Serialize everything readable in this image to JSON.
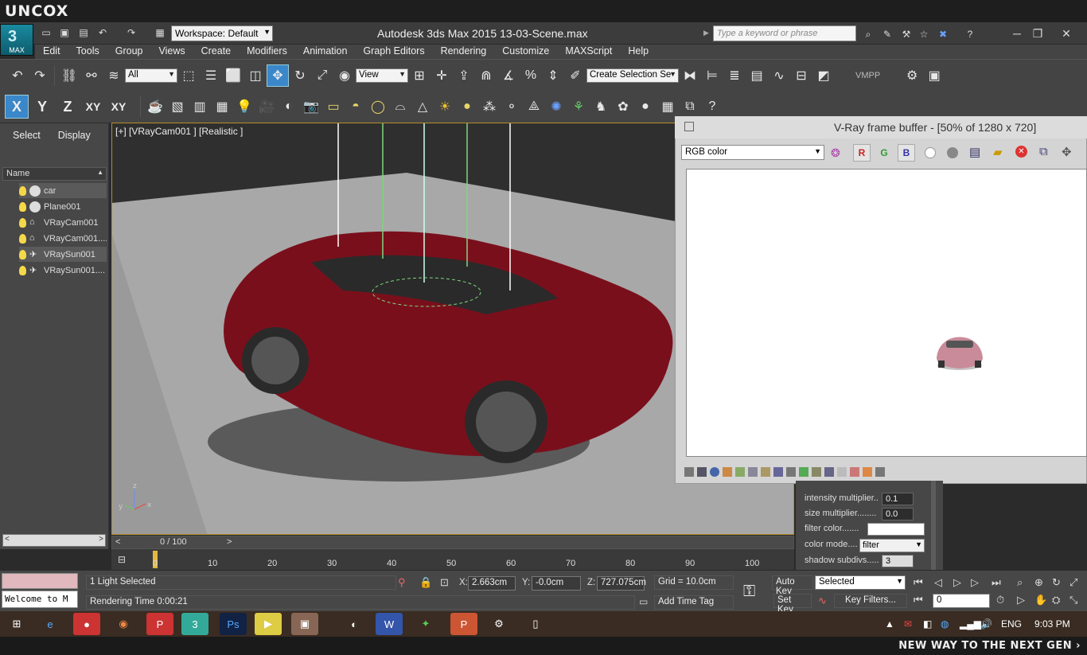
{
  "brand": {
    "watermark": "UNCOX",
    "tagline": "NEW WAY TO THE NEXT GEN ›"
  },
  "titlebar": {
    "app_icon_label": "MAX",
    "workspace": "Workspace: Default",
    "title": "Autodesk 3ds Max  2015     13-03-Scene.max",
    "search_placeholder": "Type a keyword or phrase",
    "icons": [
      "new-file-icon",
      "open-file-icon",
      "save-icon",
      "undo-icon",
      "redo-icon",
      "project-folder-icon",
      "binoculars-icon",
      "key-tools-icon",
      "exchange-icon",
      "star-icon",
      "x-icon",
      "help-icon"
    ]
  },
  "window_controls": {
    "minimize": "─",
    "restore": "❐",
    "close": "✕"
  },
  "menu": [
    "Edit",
    "Tools",
    "Group",
    "Views",
    "Create",
    "Modifiers",
    "Animation",
    "Graph Editors",
    "Rendering",
    "Customize",
    "MAXScript",
    "Help"
  ],
  "toolbar1": {
    "selection_filter": "All",
    "ref_coord": "View",
    "named_selection": "Create Selection Se",
    "vmpp_label": "VMPP"
  },
  "toolbar2": {
    "axes": [
      "X",
      "Y",
      "Z",
      "XY",
      "XY"
    ],
    "active_axis": "X"
  },
  "left_panel": {
    "tabs": [
      "Select",
      "Display"
    ],
    "column_header": "Name",
    "items": [
      {
        "label": "car",
        "icon": "sphere-icon",
        "selected": true
      },
      {
        "label": "Plane001",
        "icon": "sphere-icon",
        "selected": false
      },
      {
        "label": "VRayCam001",
        "icon": "camera-icon",
        "selected": false
      },
      {
        "label": "VRayCam001....",
        "icon": "camera-icon",
        "selected": false
      },
      {
        "label": "VRaySun001",
        "icon": "sun-light-icon",
        "selected": true
      },
      {
        "label": "VRaySun001....",
        "icon": "sun-light-icon",
        "selected": false
      }
    ]
  },
  "viewport": {
    "label": "[+] [VRayCam001 ] [Realistic ]",
    "car_color": "#7a0f1c",
    "floor_color": "#a8a8a8"
  },
  "timeline": {
    "frame": "0 / 100",
    "ticks": [
      "0",
      "10",
      "20",
      "30",
      "40",
      "50",
      "60",
      "70",
      "80",
      "90",
      "100"
    ]
  },
  "vfb": {
    "title": "V-Ray frame buffer - [50% of 1280 x 720]",
    "channel": "RGB color",
    "rgb": [
      "R",
      "G",
      "B"
    ]
  },
  "cmd_panel": {
    "params": [
      {
        "label": "intensity multiplier..",
        "value": "0.1"
      },
      {
        "label": "size multiplier........",
        "value": "0.0"
      },
      {
        "label": "filter color.......",
        "value": ""
      },
      {
        "label": "color mode....",
        "value": "filter"
      },
      {
        "label": "shadow subdivs.....",
        "value": "3"
      }
    ]
  },
  "status": {
    "selection": "1 Light Selected",
    "render_time": "Rendering Time  0:00:21",
    "welcome": "Welcome to M",
    "x": "2.663cm",
    "y": "-0.0cm",
    "z": "727.075cm",
    "x_label": "X:",
    "y_label": "Y:",
    "z_label": "Z:",
    "grid": "Grid = 10.0cm",
    "add_time_tag": "Add Time Tag",
    "auto_key": "Auto Key",
    "set_key": "Set Key",
    "key_mode": "Selected",
    "key_filters": "Key Filters...",
    "frame_field": "0"
  },
  "taskbar": {
    "lang": "ENG",
    "time": "9:03 PM"
  }
}
